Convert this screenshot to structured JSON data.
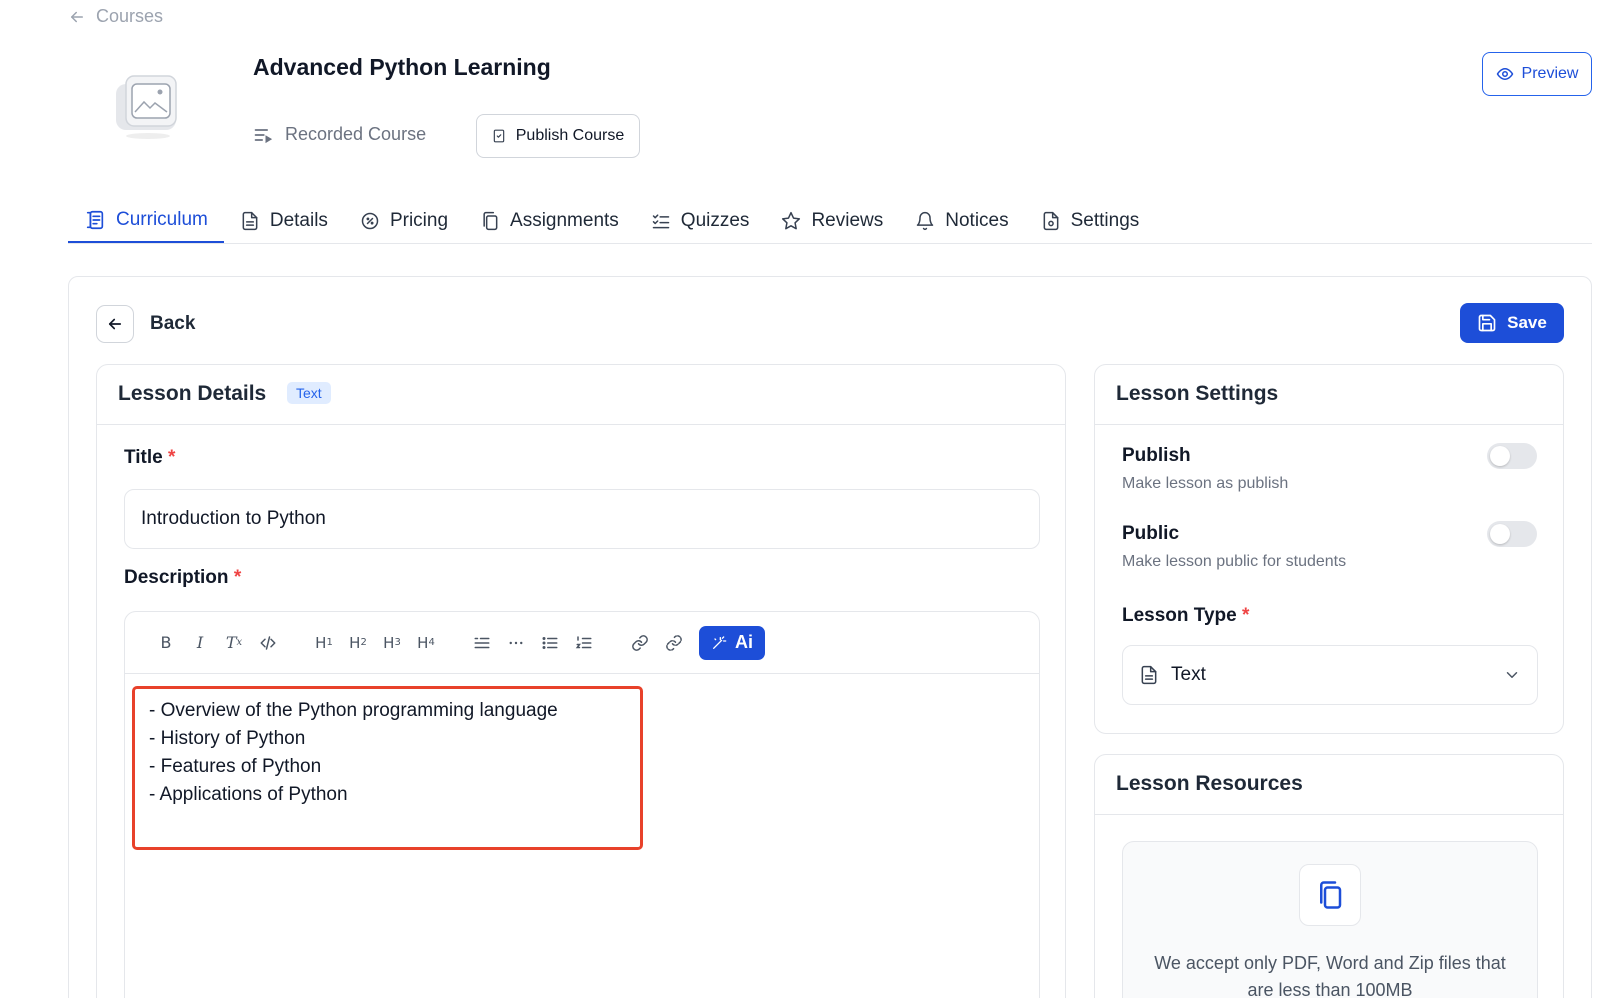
{
  "breadcrumb": {
    "label": "Courses"
  },
  "course": {
    "title": "Advanced Python Learning",
    "type": "Recorded Course",
    "publish_label": "Publish Course",
    "preview_label": "Preview"
  },
  "tabs": [
    {
      "label": "Curriculum",
      "icon": "curriculum-icon",
      "active": true
    },
    {
      "label": "Details",
      "icon": "document-icon"
    },
    {
      "label": "Pricing",
      "icon": "badge-percent-icon"
    },
    {
      "label": "Assignments",
      "icon": "copy-icon"
    },
    {
      "label": "Quizzes",
      "icon": "checklist-icon"
    },
    {
      "label": "Reviews",
      "icon": "star-icon"
    },
    {
      "label": "Notices",
      "icon": "bell-icon"
    },
    {
      "label": "Settings",
      "icon": "file-settings-icon"
    }
  ],
  "actions": {
    "back_label": "Back",
    "save_label": "Save"
  },
  "lesson_details": {
    "header": "Lesson Details",
    "badge": "Text",
    "title_label": "Title",
    "title_value": "Introduction to Python",
    "description_label": "Description",
    "required_mark": "*",
    "toolbar": [
      "B",
      "I",
      "Tx",
      "</>",
      "H1",
      "H2",
      "H3",
      "H4",
      "quote",
      "hr",
      "bullet-list",
      "ordered-list",
      "link",
      "unlink"
    ],
    "ai_label": "Ai",
    "content_lines": [
      "- Overview of the Python programming language",
      "- History of Python",
      "- Features of Python",
      "- Applications of Python"
    ]
  },
  "lesson_settings": {
    "header": "Lesson Settings",
    "publish": {
      "title": "Publish",
      "desc": "Make lesson as publish",
      "on": false
    },
    "public": {
      "title": "Public",
      "desc": "Make lesson public for students",
      "on": false
    },
    "type_label": "Lesson Type",
    "required_mark": "*",
    "type_value": "Text"
  },
  "lesson_resources": {
    "header": "Lesson Resources",
    "upload_text": "We accept only PDF, Word and Zip files that are less than 100MB"
  },
  "colors": {
    "accent": "#1d4ed8",
    "highlight_border": "#e8412a",
    "required": "#ef4444"
  }
}
